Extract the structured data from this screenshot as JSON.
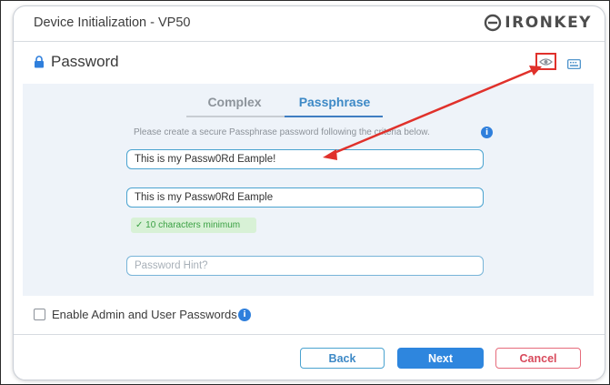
{
  "window": {
    "title": "Device Initialization - VP50",
    "logo_text": "IRONKEY"
  },
  "section": {
    "title": "Password",
    "lock_icon": "lock-icon",
    "show_password_icon": "eye-icon",
    "keyboard_icon": "keyboard-icon"
  },
  "tabs": [
    {
      "label": "Complex",
      "active": false
    },
    {
      "label": "Passphrase",
      "active": true
    }
  ],
  "instruction": "Please create a secure Passphrase password following the criteria below.",
  "fields": {
    "password_value": "This is my Passw0Rd Eample!",
    "confirm_value": "This is my Passw0Rd Eample",
    "hint_placeholder": "Password Hint?"
  },
  "criteria": [
    {
      "text": "10 characters minimum",
      "met": true
    }
  ],
  "admin_option": {
    "label": "Enable Admin and User Passwords",
    "checked": false
  },
  "buttons": {
    "back": "Back",
    "next": "Next",
    "cancel": "Cancel"
  },
  "colors": {
    "accent": "#2e86de",
    "annotation": "#e0312b",
    "success": "#3aa043",
    "cancel": "#d84a5c"
  }
}
